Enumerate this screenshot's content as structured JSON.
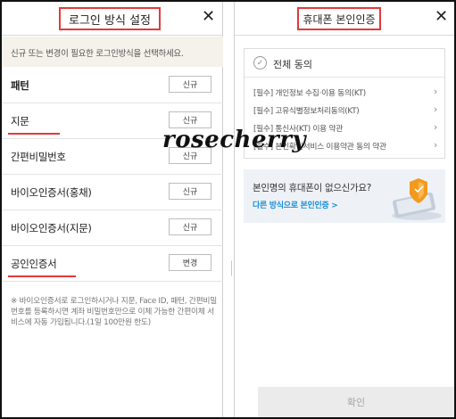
{
  "left_panel": {
    "title": "로그인 방식 설정",
    "close_glyph": "✕",
    "description": "신규 또는 변경이 필요한 로그인방식을 선택하세요.",
    "methods": [
      {
        "label": "패턴",
        "button": "신규",
        "bold": true
      },
      {
        "label": "지문",
        "button": "신규",
        "bold": false
      },
      {
        "label": "간편비밀번호",
        "button": "신규",
        "bold": false
      },
      {
        "label": "바이오인증서(홍채)",
        "button": "신규",
        "bold": false
      },
      {
        "label": "바이오인증서(지문)",
        "button": "신규",
        "bold": false
      },
      {
        "label": "공인인증서",
        "button": "변경",
        "bold": false
      }
    ],
    "note": "※ 바이오인증서로 로그인하시거나 지문, Face ID, 패턴, 간편비밀번호를 등록하시면 계좌 비밀번호만으로 이체 가능한 간편이체 서비스에 자동 가입됩니다.(1일 100만원 한도)"
  },
  "right_panel": {
    "title": "휴대폰 본인인증",
    "close_glyph": "✕",
    "consent_all": "전체 동의",
    "consent_items": [
      "[필수] 개인정보 수집·이용 동의(KT)",
      "[필수] 고유식별정보처리동의(KT)",
      "[필수] 통신사(KT) 이용 약관",
      "[필수] 본인확인서비스 이용약관 동의 약관"
    ],
    "banner_title": "본인명의 휴대폰이 없으신가요?",
    "banner_link": "다른 방식으로 본인인증 >",
    "confirm_label": "확인"
  },
  "watermark": "rosecherry",
  "colors": {
    "highlight_red": "#e23a3a",
    "link_blue": "#1a8fd6",
    "notice_bg": "#f5f2ec",
    "banner_bg": "#eef2f7"
  },
  "icons": {
    "close": "close-icon",
    "check": "check-circle-icon",
    "chevron": "chevron-right-icon",
    "banner": "phone-illustration"
  }
}
